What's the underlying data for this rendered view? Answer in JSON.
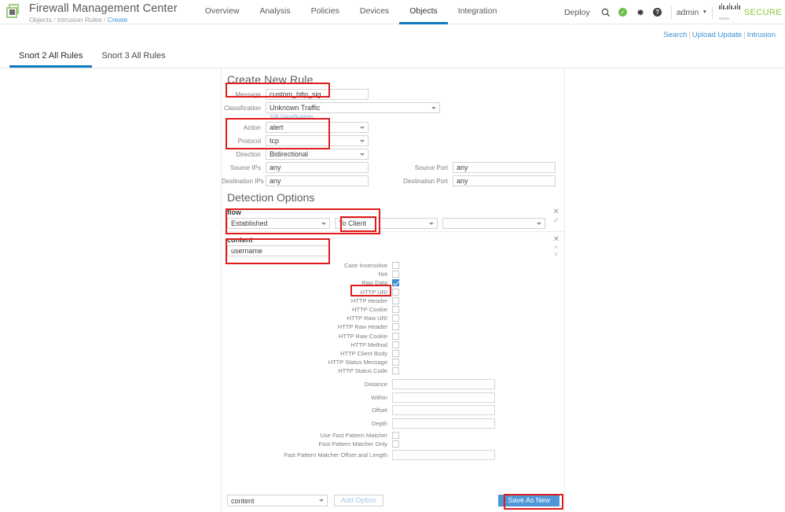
{
  "header": {
    "logo_name": "fmc-logo",
    "app_title": "Firewall Management Center",
    "breadcrumb": {
      "root": "Objects",
      "mid": "Intrusion Rules",
      "current": "Create",
      "sep": "/"
    },
    "nav": [
      {
        "label": "Overview",
        "active": false
      },
      {
        "label": "Analysis",
        "active": false
      },
      {
        "label": "Policies",
        "active": false
      },
      {
        "label": "Devices",
        "active": false
      },
      {
        "label": "Objects",
        "active": true
      },
      {
        "label": "Integration",
        "active": false
      }
    ],
    "deploy_label": "Deploy",
    "icons": {
      "search": "search-icon",
      "status": "status-ok-icon",
      "settings": "gear-icon",
      "help": "help-icon"
    },
    "admin_label": "admin",
    "cisco_label": "cisco",
    "secure_label": "SECURE",
    "accent_blue": "#0d7bc1",
    "brand_green": "#8dc63f",
    "status_green": "#6ebe4a"
  },
  "sublinks": {
    "search": "Search",
    "upload_update": "Upload Update",
    "intrusion": "Intrusion",
    "separator": "|"
  },
  "tabs": [
    {
      "label": "Snort 2 All Rules",
      "active": true
    },
    {
      "label": "Snort 3 All Rules",
      "active": false
    }
  ],
  "form": {
    "title": "Create New Rule",
    "message": {
      "label": "Message",
      "value": "custom_http_sig"
    },
    "classification": {
      "label": "Classification",
      "value": "Unknown Traffic",
      "edit_link": "Edit Classifications"
    },
    "action": {
      "label": "Action",
      "value": "alert"
    },
    "protocol": {
      "label": "Protocol",
      "value": "tcp"
    },
    "direction": {
      "label": "Direction",
      "value": "Bidirectional"
    },
    "source_ips": {
      "label": "Source IPs",
      "value": "any"
    },
    "destination_ips": {
      "label": "Destination IPs",
      "value": "any"
    },
    "source_port": {
      "label": "Source Port",
      "value": "any"
    },
    "destination_port": {
      "label": "Destination Port",
      "value": "any"
    }
  },
  "detection": {
    "title": "Detection Options",
    "flow": {
      "name": "flow",
      "select1": "Established",
      "select2": "To Client",
      "select3": "",
      "select4": ""
    },
    "content": {
      "name": "content",
      "value": "username",
      "checkboxes": [
        {
          "label": "Case Insensitive",
          "checked": false
        },
        {
          "label": "Not",
          "checked": false
        },
        {
          "label": "Raw Data",
          "checked": true
        },
        {
          "label": "HTTP URI",
          "checked": false
        },
        {
          "label": "HTTP Header",
          "checked": false
        },
        {
          "label": "HTTP Cookie",
          "checked": false
        },
        {
          "label": "HTTP Raw URI",
          "checked": false
        },
        {
          "label": "HTTP Raw Header",
          "checked": false
        },
        {
          "label": "HTTP Raw Cookie",
          "checked": false
        },
        {
          "label": "HTTP Method",
          "checked": false
        },
        {
          "label": "HTTP Client Body",
          "checked": false
        },
        {
          "label": "HTTP Status Message",
          "checked": false
        },
        {
          "label": "HTTP Status Code",
          "checked": false
        }
      ],
      "textfields": [
        {
          "label": "Distance",
          "value": ""
        },
        {
          "label": "Within",
          "value": ""
        },
        {
          "label": "Offset",
          "value": ""
        },
        {
          "label": "Depth",
          "value": ""
        }
      ],
      "fastpattern": [
        {
          "label": "Use Fast Pattern Matcher",
          "checked": false
        },
        {
          "label": "Fast Pattern Matcher Only",
          "checked": false
        }
      ],
      "fp_offset": {
        "label": "Fast Pattern Matcher Offset and Length",
        "value": ""
      }
    }
  },
  "actions": {
    "option_select": "content",
    "add_option": "Add Option",
    "save_as_new": "Save As New",
    "save_color": "#4f96d6"
  },
  "annotations": {
    "highlight_color": "#e01b1b"
  }
}
